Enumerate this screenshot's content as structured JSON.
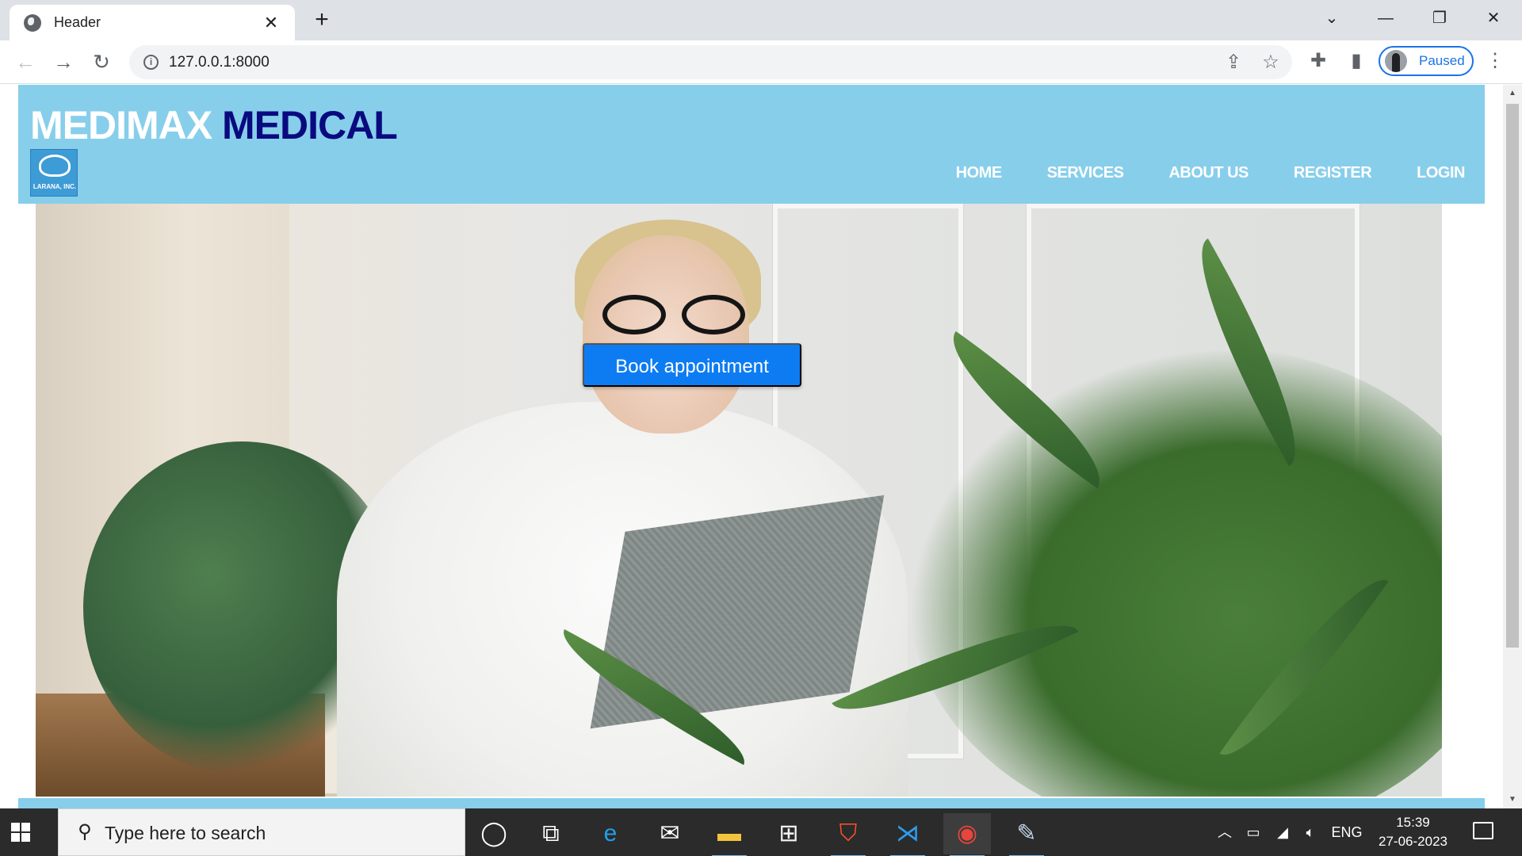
{
  "browser": {
    "tab_title": "Header",
    "tab_close": "✕",
    "new_tab": "+",
    "url": "127.0.0.1:8000",
    "profile_label": "Paused",
    "window_controls": {
      "dropdown": "⌄",
      "minimize": "—",
      "restore": "❐",
      "close": "✕"
    },
    "nav": {
      "back": "←",
      "forward": "→",
      "reload": "↻"
    },
    "icons": [
      "info-icon",
      "share-icon",
      "star-icon",
      "extensions-icon",
      "side-panel-icon",
      "menu-icon"
    ],
    "accent_color": "#1a73e8"
  },
  "site": {
    "brand_part1": "MEDIMAX",
    "brand_part2": "MEDICAL",
    "logo_text": "LARANA, INC.",
    "header_color": "#87ceeb",
    "nav_items": [
      "HOME",
      "SERVICES",
      "ABOUT US",
      "REGISTER",
      "LOGIN"
    ],
    "cta_label": "Book appointment",
    "cta_color": "#0d7cf2"
  },
  "taskbar": {
    "search_placeholder": "Type here to search",
    "language": "ENG",
    "time": "15:39",
    "date": "27-06-2023",
    "apps": [
      "cortana",
      "task-view",
      "edge",
      "mail",
      "file-explorer",
      "store",
      "brave",
      "vscode",
      "chrome",
      "paint"
    ]
  }
}
